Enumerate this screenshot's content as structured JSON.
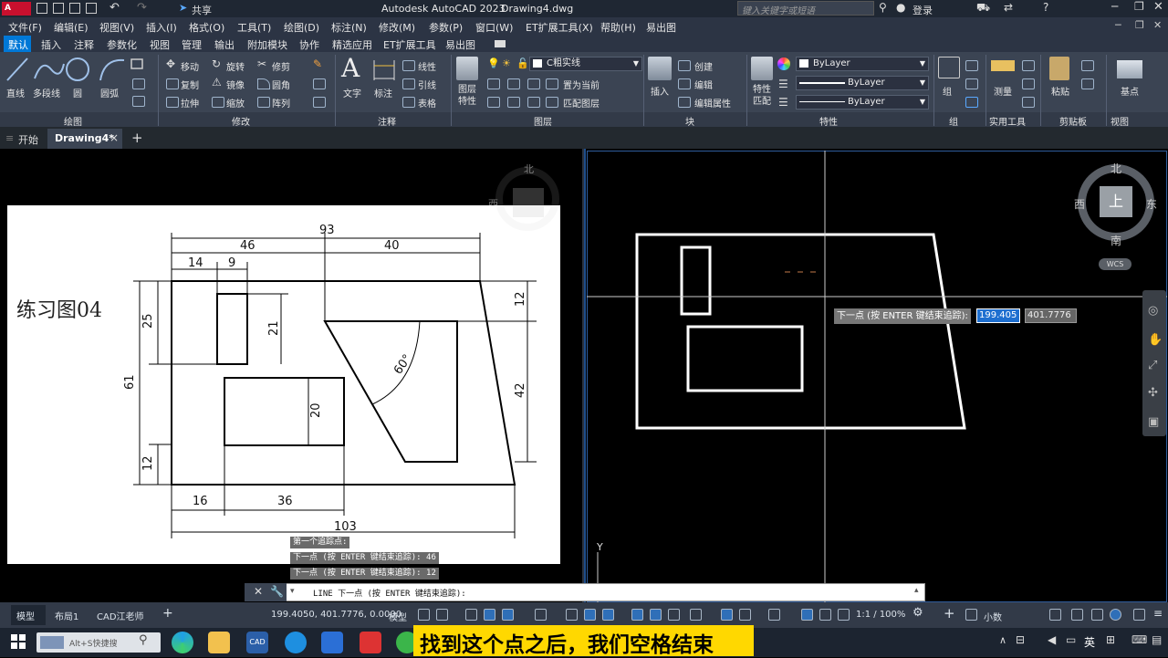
{
  "app": {
    "logo": "A CAD",
    "title": "Autodesk AutoCAD 2023",
    "file": "Drawing4.dwg",
    "search_placeholder": "键入关键字或短语",
    "login": "登录",
    "share": "共享"
  },
  "menu": [
    "文件(F)",
    "编辑(E)",
    "视图(V)",
    "插入(I)",
    "格式(O)",
    "工具(T)",
    "绘图(D)",
    "标注(N)",
    "修改(M)",
    "参数(P)",
    "窗口(W)",
    "ET扩展工具(X)",
    "帮助(H)",
    "易出图"
  ],
  "tabs": [
    "默认",
    "插入",
    "注释",
    "参数化",
    "视图",
    "管理",
    "输出",
    "附加模块",
    "协作",
    "精选应用",
    "ET扩展工具",
    "易出图"
  ],
  "ribbon": {
    "draw": {
      "line": "直线",
      "polyline": "多段线",
      "circle": "圆",
      "arc": "圆弧",
      "panel": "绘图"
    },
    "modify": {
      "move": "移动",
      "rotate": "旋转",
      "trim": "修剪",
      "copy": "复制",
      "mirror": "镜像",
      "fillet": "圆角",
      "stretch": "拉伸",
      "scale": "缩放",
      "array": "阵列",
      "panel": "修改"
    },
    "annot": {
      "text": "文字",
      "dim": "标注",
      "linear": "线性",
      "leader": "引线",
      "table": "表格",
      "panel": "注释"
    },
    "layers": {
      "props": "图层\n特性",
      "current_layer": "C粗实线",
      "set_current": "置为当前",
      "match": "匹配图层",
      "panel": "图层"
    },
    "block": {
      "insert": "插入",
      "create": "创建",
      "edit": "编辑",
      "edit_attr": "编辑属性",
      "panel": "块"
    },
    "props": {
      "match": "特性\n匹配",
      "color": "ByLayer",
      "lineweight": "ByLayer",
      "linetype": "ByLayer",
      "panel": "特性"
    },
    "group": {
      "group": "组",
      "panel": "组"
    },
    "util": {
      "measure": "测量",
      "panel": "实用工具"
    },
    "clip": {
      "paste": "粘贴",
      "panel": "剪贴板"
    },
    "view": {
      "base": "基点",
      "panel": "视图"
    }
  },
  "filetabs": {
    "start": "开始",
    "drawing": "Drawing4*",
    "close": "×",
    "new": "+"
  },
  "reference": {
    "title": "练习图04",
    "dims": {
      "d93": "93",
      "d46": "46",
      "d40": "40",
      "d14": "14",
      "d9": "9",
      "d25": "25",
      "d21": "21",
      "d61": "61",
      "d20": "20",
      "d12a": "12",
      "d12b": "12",
      "d42": "42",
      "d60": "60°",
      "d16": "16",
      "d36": "36",
      "d103": "103"
    }
  },
  "viewcube": {
    "n": "北",
    "s": "南",
    "e": "东",
    "w": "西",
    "top": "上",
    "wcs": "WCS"
  },
  "tooltip": {
    "prompt": "下一点 (按 ENTER 键结束追踪):",
    "x": "199.405",
    "y": "401.7776"
  },
  "history": [
    "第一个追踪点:",
    "下一点 (按 ENTER 键结束追踪): 46",
    "下一点 (按 ENTER 键结束追踪): 12"
  ],
  "command": {
    "text": "LINE 下一点 (按 ENTER 键结束追踪):"
  },
  "ucs": "Y",
  "layout_tabs": [
    "模型",
    "布局1",
    "CAD江老师"
  ],
  "status": {
    "coords": "199.4050, 401.7776, 0.0000",
    "model": "模型",
    "scale": "1:1 / 100%",
    "units": "小数"
  },
  "taskbar": {
    "search": "Alt+S快捷搜",
    "ime": "英",
    "subtitle": "找到这个点之后，我们空格结束"
  },
  "colors": {
    "accent": "#0078d7",
    "ribbon": "#3b4453",
    "canvas": "#000000"
  }
}
